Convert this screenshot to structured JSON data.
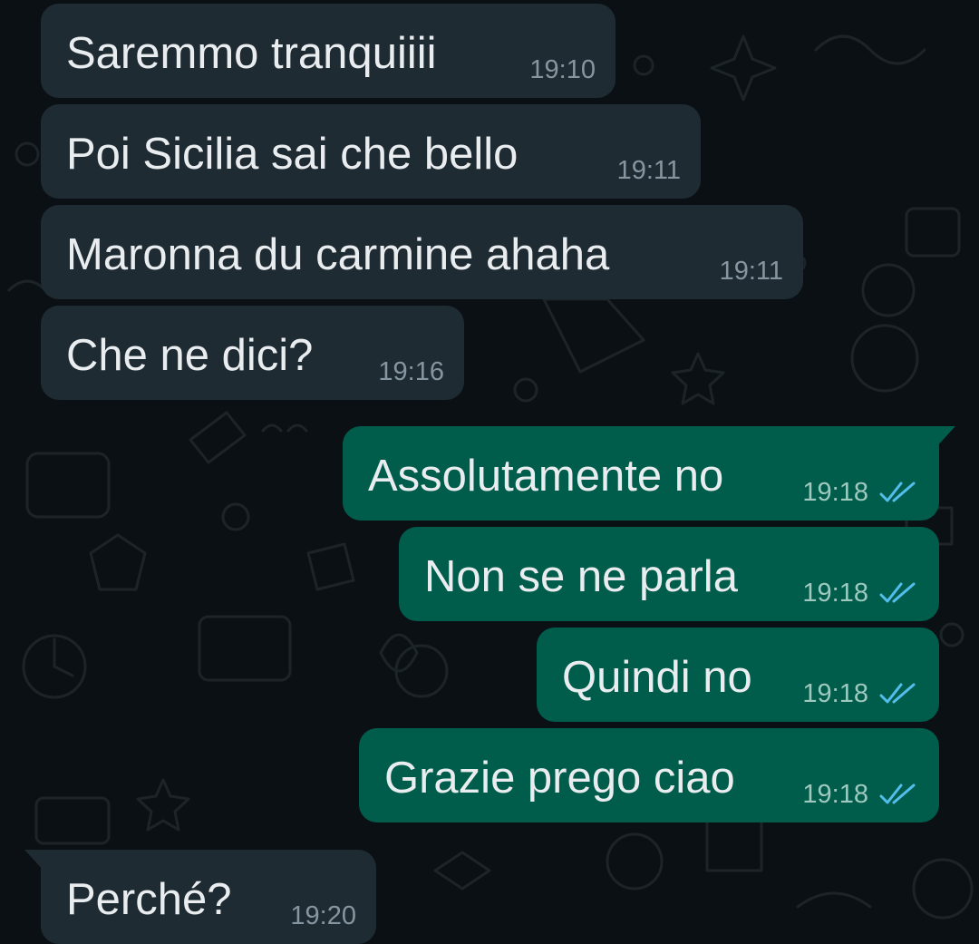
{
  "messages": [
    {
      "direction": "incoming",
      "text": "Saremmo tranquiiii",
      "time": "19:10"
    },
    {
      "direction": "incoming",
      "text": "Poi Sicilia sai che bello",
      "time": "19:11"
    },
    {
      "direction": "incoming",
      "text": "Maronna du carmine ahaha",
      "time": "19:11"
    },
    {
      "direction": "incoming",
      "text": "Che ne dici?",
      "time": "19:16"
    },
    {
      "direction": "outgoing",
      "text": "Assolutamente no",
      "time": "19:18",
      "status": "read"
    },
    {
      "direction": "outgoing",
      "text": "Non se ne parla",
      "time": "19:18",
      "status": "read"
    },
    {
      "direction": "outgoing",
      "text": "Quindi no",
      "time": "19:18",
      "status": "read"
    },
    {
      "direction": "outgoing",
      "text": "Grazie prego ciao",
      "time": "19:18",
      "status": "read"
    },
    {
      "direction": "incoming",
      "text": "Perché?",
      "time": "19:20"
    }
  ],
  "icons": {
    "read_receipt": "double-check-icon",
    "wallpaper": "doodle-pattern"
  },
  "colors": {
    "background": "#0b1014",
    "incoming_bubble": "#1f2b33",
    "outgoing_bubble": "#005c4b",
    "message_text": "#e9edef",
    "incoming_time": "#8696a0",
    "outgoing_time": "#9fc9be",
    "read_ticks": "#53bdeb"
  }
}
